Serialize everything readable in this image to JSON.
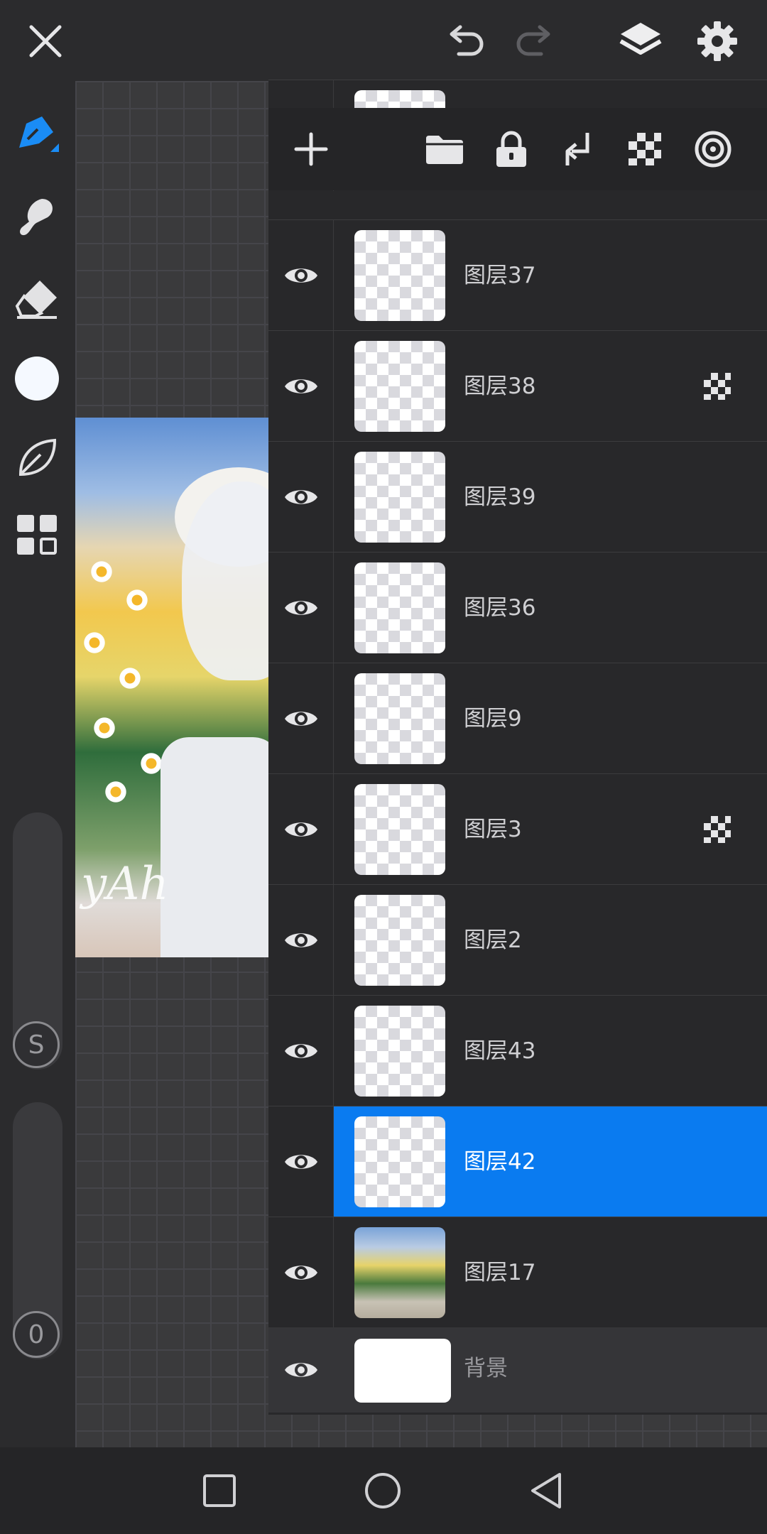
{
  "topbar": {
    "icons": [
      "close-icon",
      "undo-icon",
      "redo-icon",
      "layers-icon",
      "gear-icon"
    ]
  },
  "toolbar": {
    "tools": [
      "pen-icon",
      "smudge-icon",
      "eraser-icon",
      "color-swatch",
      "leaf-icon",
      "grid-icon"
    ],
    "accent_color": "#1a8cf5",
    "color_value": "#f5f9ff"
  },
  "sliders": {
    "size_label": "S",
    "opacity_label": "0"
  },
  "layers_panel": {
    "header_icons": [
      "add-layer-icon",
      "folder-icon",
      "lock-icon",
      "merge-down-icon",
      "alpha-lock-icon",
      "blend-mode-icon"
    ],
    "layers": [
      {
        "name": "图层37",
        "alpha_lock": false,
        "selected": false
      },
      {
        "name": "图层38",
        "alpha_lock": true,
        "selected": false
      },
      {
        "name": "图层39",
        "alpha_lock": false,
        "selected": false
      },
      {
        "name": "图层36",
        "alpha_lock": false,
        "selected": false
      },
      {
        "name": "图层9",
        "alpha_lock": false,
        "selected": false
      },
      {
        "name": "图层3",
        "alpha_lock": true,
        "selected": false
      },
      {
        "name": "图层2",
        "alpha_lock": false,
        "selected": false
      },
      {
        "name": "图层43",
        "alpha_lock": false,
        "selected": false
      },
      {
        "name": "图层42",
        "alpha_lock": false,
        "selected": true
      },
      {
        "name": "图层17",
        "alpha_lock": false,
        "selected": false
      }
    ],
    "background": {
      "name": "背景"
    },
    "selected_color": "#0a7bf0"
  },
  "artwork": {
    "signature": "yAh"
  },
  "navbar": {
    "icons": [
      "recents-icon",
      "home-icon",
      "back-icon"
    ]
  }
}
